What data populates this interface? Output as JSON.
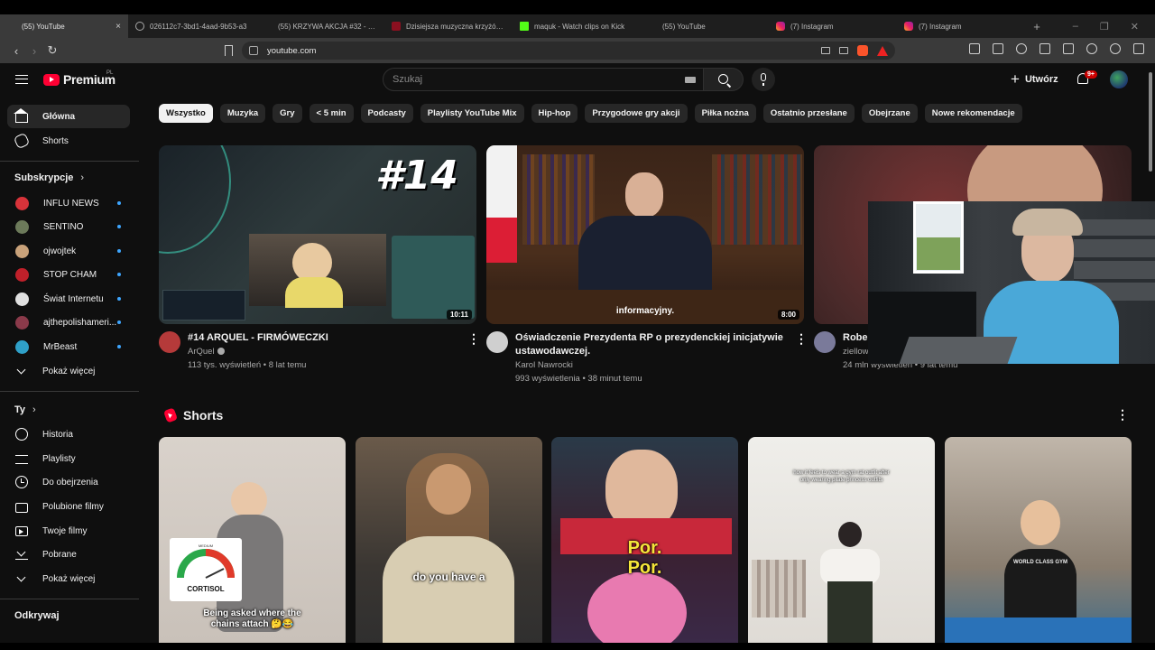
{
  "browser": {
    "tabs": [
      {
        "title": "(55) YouTube",
        "icon": "youtube-icon",
        "active": true
      },
      {
        "title": "026112c7-3bd1-4aad-9b53-a3",
        "icon": "globe-icon"
      },
      {
        "title": "(55) KRZYWA AKCJA #32 - NIE",
        "icon": "youtube-icon"
      },
      {
        "title": "Dzisiejsza muzyczna krzyżówka",
        "icon": "red-square-icon"
      },
      {
        "title": "maquk - Watch clips on Kick",
        "icon": "kick-icon"
      },
      {
        "title": "(55) YouTube",
        "icon": "youtube-icon"
      },
      {
        "title": "(7) Instagram",
        "icon": "instagram-icon"
      },
      {
        "title": "(7) Instagram",
        "icon": "instagram-icon"
      }
    ],
    "close_glyph": "×",
    "new_tab_glyph": "+",
    "url": "youtube.com"
  },
  "youtube": {
    "logo_text": "Premium",
    "country_code": "PL",
    "search_placeholder": "Szukaj",
    "create_label": "Utwórz",
    "notifications_badge": "9+",
    "sidebar": {
      "main": [
        {
          "label": "Główna",
          "icon": "home-icon",
          "active": true
        },
        {
          "label": "Shorts",
          "icon": "shorts-icon"
        }
      ],
      "subscriptions_title": "Subskrypcje",
      "subscriptions": [
        {
          "label": "INFLU NEWS",
          "color": "#d8333a"
        },
        {
          "label": "SENTINO",
          "color": "#6c7a5a"
        },
        {
          "label": "ojwojtek",
          "color": "#c9a27a"
        },
        {
          "label": "STOP CHAM",
          "color": "#c0202a"
        },
        {
          "label": "Świat Internetu",
          "color": "#e0e0e0"
        },
        {
          "label": "ajthepolishameri...",
          "color": "#8a3a4a"
        },
        {
          "label": "MrBeast",
          "color": "#2fa0c8"
        }
      ],
      "show_more_1": "Pokaż więcej",
      "you_title": "Ty",
      "you_items": [
        {
          "label": "Historia",
          "icon": "history-icon"
        },
        {
          "label": "Playlisty",
          "icon": "playlist-icon"
        },
        {
          "label": "Do obejrzenia",
          "icon": "watch-later-icon"
        },
        {
          "label": "Polubione filmy",
          "icon": "like-icon"
        },
        {
          "label": "Twoje filmy",
          "icon": "your-videos-icon"
        },
        {
          "label": "Pobrane",
          "icon": "download-icon"
        }
      ],
      "show_more_2": "Pokaż więcej",
      "explore_title": "Odkrywaj"
    },
    "chips": [
      "Wszystko",
      "Muzyka",
      "Gry",
      "< 5 min",
      "Podcasty",
      "Playlisty YouTube Mix",
      "Hip-hop",
      "Przygodowe gry akcji",
      "Piłka nożna",
      "Ostatnio przesłane",
      "Obejrzane",
      "Nowe rekomendacje"
    ],
    "videos": [
      {
        "title": "#14 ARQUEL - FIRMÓWECZKI",
        "channel": "ArQuel",
        "meta": "113 tys. wyświetleń • 8 lat temu",
        "duration": "10:11",
        "overlay_text": "#14",
        "avatar_color": "#b53a3a"
      },
      {
        "title_line1": "Oświadczenie Prezydenta RP o prezydenckiej inicjatywie",
        "title_line2": "ustawodawczej.",
        "channel": "Karol Nawrocki",
        "meta": "993 wyświetlenia • 38 minut temu",
        "duration": "8:00",
        "caption": "informacyjny.",
        "avatar_color": "#cfcfcf"
      },
      {
        "title": "Rober",
        "channel": "ziellow",
        "meta": "24 mln wyświetleń • 9 lat temu",
        "avatar_color": "#7a7a9a"
      }
    ],
    "shorts_title": "Shorts",
    "shorts": [
      {
        "caption": "Being asked where the chains attach 🤔😂",
        "gauge_label": "CORTISOL",
        "gauge_top": "MEDIUM"
      },
      {
        "caption": "do you have a"
      },
      {
        "caption_1": "Por.",
        "caption_2": "Por."
      },
      {
        "caption": "how it feels to wear a gym rat outfit after only wearing pilate princess outfits"
      },
      {
        "jersey": "WORLD CLASS GYM"
      }
    ]
  }
}
